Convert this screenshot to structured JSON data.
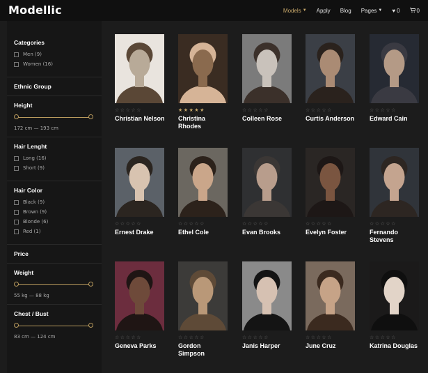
{
  "header": {
    "logo": "Modellic",
    "nav": [
      {
        "label": "Models",
        "caret": true,
        "active": true
      },
      {
        "label": "Apply",
        "caret": false,
        "active": false
      },
      {
        "label": "Blog",
        "caret": false,
        "active": false
      },
      {
        "label": "Pages",
        "caret": true,
        "active": false
      }
    ],
    "wishlist": {
      "icon": "heart-icon",
      "count": "0"
    },
    "cart": {
      "icon": "cart-icon",
      "count": "0"
    }
  },
  "sidebar": {
    "categories": {
      "title": "Categories",
      "options": [
        "Men (9)",
        "Women (16)"
      ]
    },
    "ethnic_group": {
      "title": "Ethnic Group"
    },
    "height": {
      "title": "Height",
      "range": "172 cm — 193 cm"
    },
    "hair_length": {
      "title": "Hair Lenght",
      "options": [
        "Long (16)",
        "Short (9)"
      ]
    },
    "hair_color": {
      "title": "Hair Color",
      "options": [
        "Black (9)",
        "Brown (9)",
        "Blonde (6)",
        "Red (1)"
      ]
    },
    "price": {
      "title": "Price"
    },
    "weight": {
      "title": "Weight",
      "range": "55 kg — 88 kg"
    },
    "chest": {
      "title": "Chest / Bust",
      "range": "83 cm — 124 cm"
    }
  },
  "models": [
    {
      "name": "Christian Nelson",
      "rating": 0
    },
    {
      "name": "Christina Rhodes",
      "rating": 5
    },
    {
      "name": "Colleen Rose",
      "rating": 0
    },
    {
      "name": "Curtis Anderson",
      "rating": 0
    },
    {
      "name": "Edward Cain",
      "rating": 0
    },
    {
      "name": "Ernest Drake",
      "rating": 0
    },
    {
      "name": "Ethel Cole",
      "rating": 0
    },
    {
      "name": "Evan Brooks",
      "rating": 0
    },
    {
      "name": "Evelyn Foster",
      "rating": 0
    },
    {
      "name": "Fernando Stevens",
      "rating": 0
    },
    {
      "name": "Geneva Parks",
      "rating": 0
    },
    {
      "name": "Gordon Simpson",
      "rating": 0
    },
    {
      "name": "Janis Harper",
      "rating": 0
    },
    {
      "name": "June Cruz",
      "rating": 0
    },
    {
      "name": "Katrina Douglas",
      "rating": 0
    }
  ],
  "colors": {
    "accent": "#c8a86a",
    "background": "#1c1c1c",
    "header": "#101010"
  }
}
